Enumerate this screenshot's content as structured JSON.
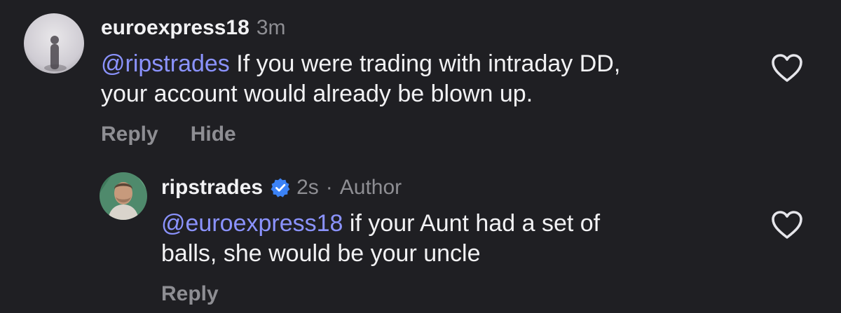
{
  "comments": [
    {
      "username": "euroexpress18",
      "timestamp": "3m",
      "mention": "@ripstrades",
      "text_line1": " If you were trading with intraday DD,",
      "text_line2": "your account would already be blown up.",
      "actions": {
        "reply": "Reply",
        "hide": "Hide"
      },
      "avatar_icon": "user-avatar-photo",
      "like_icon": "heart-outline-icon"
    },
    {
      "username": "ripstrades",
      "verified": true,
      "verified_icon": "verified-badge-icon",
      "timestamp": "2s",
      "separator": "·",
      "author_tag": "Author",
      "mention": "@euroexpress18",
      "text_line1": " if your Aunt had a set of",
      "text_line2": "balls, she would be your uncle",
      "actions": {
        "reply": "Reply"
      },
      "avatar_icon": "user-avatar-photo",
      "like_icon": "heart-outline-icon"
    }
  ],
  "colors": {
    "background": "#1f1f23",
    "text": "#f2f2f4",
    "muted": "#8e8e93",
    "mention": "#8b93ff",
    "verified": "#3b82f6"
  }
}
